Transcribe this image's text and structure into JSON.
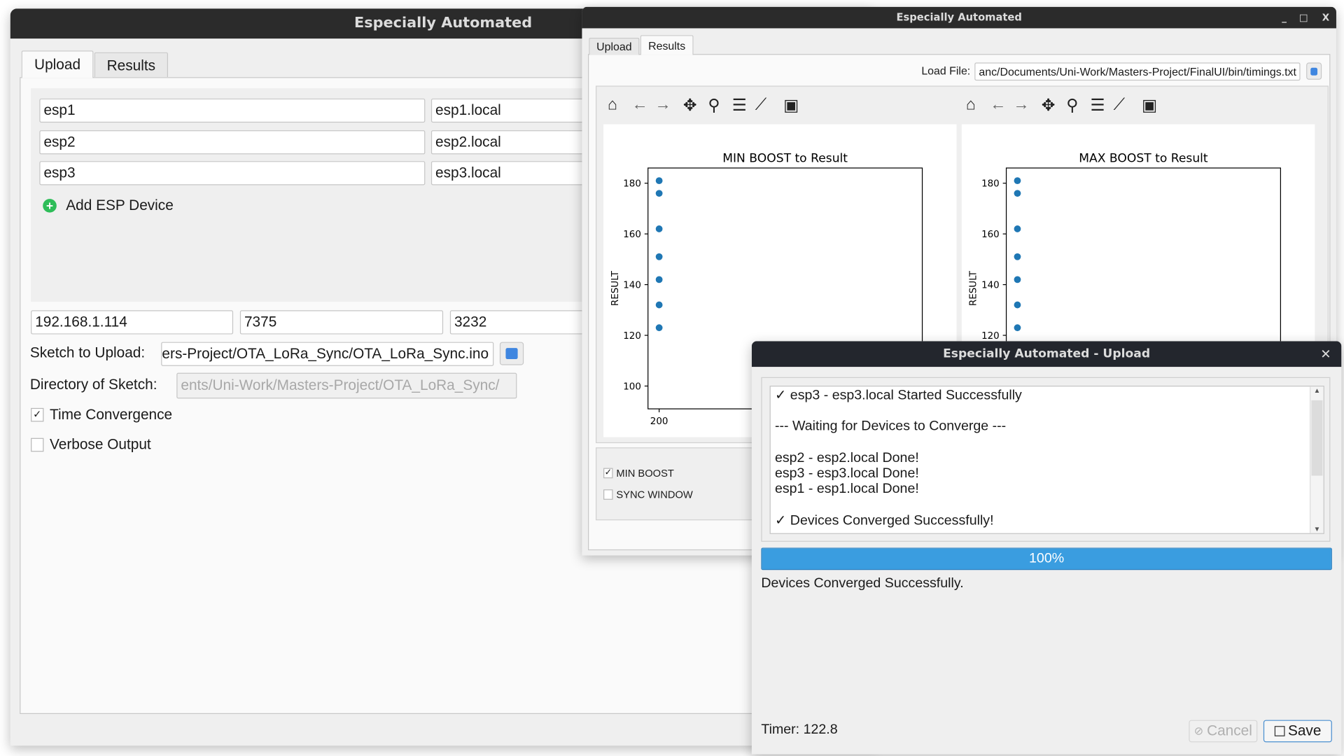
{
  "main_window": {
    "title": "Especially Automated",
    "tabs": [
      {
        "label": "Upload",
        "active": true
      },
      {
        "label": "Results",
        "active": false
      }
    ],
    "devices": [
      {
        "name": "esp1",
        "host": "esp1.local"
      },
      {
        "name": "esp2",
        "host": "esp2.local"
      },
      {
        "name": "esp3",
        "host": "esp3.local"
      }
    ],
    "add_device_label": "Add ESP Device",
    "ip": "192.168.1.114",
    "port1": "7375",
    "port2": "3232",
    "sketch_label": "Sketch to Upload:",
    "sketch_value": "ers-Project/OTA_LoRa_Sync/OTA_LoRa_Sync.ino",
    "directory_label": "Directory of Sketch:",
    "directory_value": "ents/Uni-Work/Masters-Project/OTA_LoRa_Sync/",
    "time_convergence": {
      "label": "Time Convergence",
      "checked": true
    },
    "verbose_output": {
      "label": "Verbose Output",
      "checked": false
    }
  },
  "results_window": {
    "title": "Especially Automated",
    "controls": [
      "_",
      "□",
      "X"
    ],
    "tabs": [
      {
        "label": "Upload",
        "active": false
      },
      {
        "label": "Results",
        "active": true
      }
    ],
    "load_file_label": "Load File:",
    "load_file_value": "anc/Documents/Uni-Work/Masters-Project/FinalUI/bin/timings.txt",
    "toolbar_icons": [
      "home-icon",
      "back-arrow-icon",
      "forward-arrow-icon",
      "pan-icon",
      "zoom-icon",
      "configure-subplots-icon",
      "edit-axis-icon",
      "save-icon"
    ],
    "options": [
      {
        "label": "MIN BOOST",
        "checked": true
      },
      {
        "label": "SYNC WINDOW",
        "checked": false
      }
    ]
  },
  "chart_data": [
    {
      "type": "scatter",
      "title": "MIN BOOST to Result",
      "ylabel": "RESULT",
      "xlabel": "",
      "x_ticks": [
        200
      ],
      "y_ticks": [
        100,
        120,
        140,
        160,
        180
      ],
      "ylim": [
        91,
        186
      ],
      "color": "#1f77b4",
      "points": [
        [
          200,
          181
        ],
        [
          200,
          176
        ],
        [
          200,
          162
        ],
        [
          200,
          151
        ],
        [
          200,
          142
        ],
        [
          200,
          132
        ],
        [
          200,
          123
        ]
      ]
    },
    {
      "type": "scatter",
      "title": "MAX BOOST to Result",
      "ylabel": "RESULT",
      "xlabel": "",
      "x_ticks": [],
      "y_ticks": [
        120,
        140,
        160,
        180
      ],
      "ylim": [
        91,
        186
      ],
      "color": "#1f77b4",
      "points": [
        [
          200,
          181
        ],
        [
          200,
          176
        ],
        [
          200,
          162
        ],
        [
          200,
          151
        ],
        [
          200,
          142
        ],
        [
          200,
          132
        ],
        [
          200,
          123
        ]
      ]
    }
  ],
  "upload_dialog": {
    "title": "Especially Automated - Upload",
    "log_lines": [
      "✓ esp3 - esp3.local Started Successfully",
      "",
      "--- Waiting for Devices to Converge ---",
      "",
      "esp2 - esp2.local Done!",
      "esp3 - esp3.local Done!",
      "esp1 - esp1.local Done!",
      "",
      "✓ Devices Converged Successfully!"
    ],
    "progress_percent": 100,
    "progress_label": "100%",
    "progress_color": "#3a9de0",
    "status": "Devices Converged Successfully.",
    "timer": "Timer: 122.8",
    "cancel_label": "Cancel",
    "save_label": "Save"
  }
}
